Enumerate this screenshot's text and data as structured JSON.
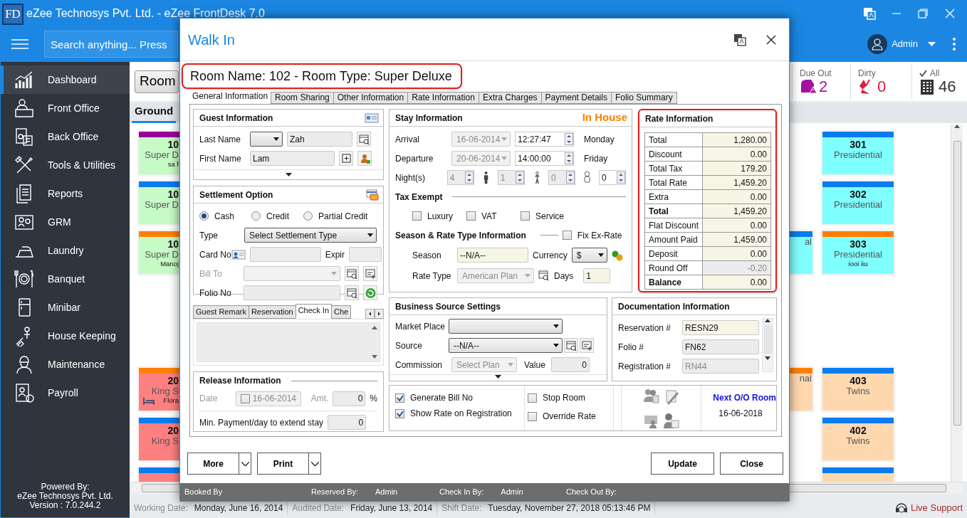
{
  "window": {
    "logo": "FD",
    "title": "eZee Technosys Pvt. Ltd. - eZee FrontDesk 7.0"
  },
  "header": {
    "search": {
      "placeholder": "Search anything... Press"
    },
    "user": "Admin"
  },
  "sidebar": {
    "items": [
      {
        "label": "Dashboard",
        "selected": true
      },
      {
        "label": "Front Office",
        "selected": false
      },
      {
        "label": "Back Office",
        "selected": false
      },
      {
        "label": "Tools & Utilities",
        "selected": false
      },
      {
        "label": "Reports",
        "selected": false
      },
      {
        "label": "GRM",
        "selected": false
      },
      {
        "label": "Laundry",
        "selected": false
      },
      {
        "label": "Banquet",
        "selected": false
      },
      {
        "label": "Minibar",
        "selected": false
      },
      {
        "label": "House Keeping",
        "selected": false
      },
      {
        "label": "Maintenance",
        "selected": false
      },
      {
        "label": "Payroll",
        "selected": false
      }
    ],
    "footer": [
      "Powered By:",
      "eZee Technosys Pvt. Ltd.",
      "Version : 7.0.244.2"
    ]
  },
  "toolbar": {
    "view_button": "Room",
    "stats": [
      {
        "label": "Due Out",
        "value": "2",
        "color": "#a3139f"
      },
      {
        "label": "Dirty",
        "value": "0",
        "color": "#e8173c"
      },
      {
        "label": "All",
        "value": "46",
        "color": "#333333"
      }
    ]
  },
  "floor_tab": "Ground",
  "rooms": {
    "left": [
      {
        "number": "10",
        "type": "Super D",
        "guest": "sa f",
        "color": "#c6fbc6",
        "strip": {
          "color": "#990099"
        },
        "occupied": false
      },
      {
        "number": "10",
        "type": "Super D",
        "color": "#c6fbc6",
        "strip": {
          "color": "#0a7cf0"
        },
        "occupied": false
      },
      {
        "number": "10",
        "type": "Super D",
        "guest": "Manoj",
        "color": "#c6fbc6",
        "strip": {
          "color": "#ff7f00"
        },
        "occupied": false
      },
      {
        "number": "20",
        "type": "King S",
        "guest": "Flora",
        "color": "#ff8080",
        "strip": {
          "color": "#ff7f00"
        },
        "occupied": true
      },
      {
        "number": "20",
        "type": "King S",
        "color": "#ff8080",
        "strip": {
          "color": "#0a7cf0"
        },
        "occupied": false
      },
      {
        "color": "#ff8080",
        "strip": {
          "color": "#0a7cf0"
        },
        "occupied": false
      }
    ],
    "partial": [
      {
        "type": "al",
        "color": "#80ffff",
        "strip": {
          "color": "#0a7cf0"
        },
        "occupied": false
      },
      {
        "type": "nal",
        "color": "#ffd8b0",
        "strip": {
          "color": "#ff7f00"
        },
        "occupied": false
      }
    ],
    "right": [
      {
        "number": "301",
        "type": "Presidential",
        "color": "#80ffff",
        "strip": {
          "color": "#0a7cf0"
        },
        "occupied": false
      },
      {
        "number": "302",
        "type": "Presidential",
        "color": "#80ffff",
        "strip": {
          "color": "#0a7cf0"
        },
        "occupied": false
      },
      {
        "number": "303",
        "type": "Presidential",
        "guest": "iooi iiu",
        "color": "#80ffff",
        "strip": {
          "color": "#ff7f00"
        },
        "occupied": false
      },
      {
        "number": "403",
        "type": "Twins",
        "color": "#ffd8b0",
        "strip": {
          "color": "#0a7cf0"
        },
        "occupied": false
      },
      {
        "number": "402",
        "type": "Twins",
        "color": "#ffd8b0",
        "strip": {
          "color": "#0a7cf0"
        },
        "occupied": false
      },
      {
        "color": "#ffd8b0",
        "strip": {
          "color": "#0a7cf0"
        },
        "occupied": false
      }
    ]
  },
  "dialog": {
    "title": "Walk In",
    "room_heading": "Room Name: 102 - Room Type: Super Deluxe",
    "tabs": [
      {
        "label": "General Information",
        "selected": true
      },
      {
        "label": "Room Sharing",
        "selected": false
      },
      {
        "label": "Other Information",
        "selected": false
      },
      {
        "label": "Rate Information",
        "selected": false
      },
      {
        "label": "Extra Charges",
        "selected": false
      },
      {
        "label": "Payment Details",
        "selected": false
      },
      {
        "label": "Folio Summary",
        "selected": false
      }
    ],
    "guest": {
      "title": "Guest Information",
      "last_name_label": "Last Name",
      "last_name": "Zah",
      "first_name_label": "First Name",
      "first_name": "Lam"
    },
    "settlement": {
      "title": "Settlement Option",
      "modes": [
        {
          "label": "Cash",
          "selected": true
        },
        {
          "label": "Credit",
          "selected": false
        },
        {
          "label": "Partial Credit",
          "selected": false
        }
      ],
      "type_label": "Type",
      "type": "Select Settlement Type",
      "card_label": "Card No",
      "expiry_label": "Expir",
      "bill_to_label": "Bill To",
      "bill_to_disabled": true,
      "folio_label": "Folio No"
    },
    "remark_tabs": [
      {
        "label": "Guest Remark",
        "selected": false
      },
      {
        "label": "Reservation",
        "selected": false
      },
      {
        "label": "Check In",
        "selected": true
      },
      {
        "label": "Che",
        "selected": false
      }
    ],
    "release": {
      "title": "Release Information",
      "date_label": "Date",
      "date": "16-06-2014",
      "date_checked": false,
      "amount_label": "Amt.",
      "amount": "0",
      "unit": "%",
      "min_payment_label": "Min. Payment/day to extend stay",
      "min_payment": "0"
    },
    "stay": {
      "title": "Stay Information",
      "status": "In House",
      "rows": [
        {
          "label": "Arrival",
          "date": "16-06-2014",
          "time": "12:27:47",
          "day": "Monday"
        },
        {
          "label": "Departure",
          "date": "20-06-2014",
          "time": "14:00:00",
          "day": "Friday"
        }
      ],
      "nights_label": "Night(s)",
      "counts": [
        {
          "value": "4",
          "disabled": true
        },
        {
          "value": "1",
          "disabled": true
        },
        {
          "value": "0",
          "disabled": true
        },
        {
          "value": "0",
          "disabled": false
        }
      ],
      "tax_title": "Tax Exempt",
      "tax_exempt": [
        {
          "label": "Luxury",
          "checked": false
        },
        {
          "label": "VAT",
          "checked": false
        },
        {
          "label": "Service",
          "checked": false
        }
      ],
      "season_title": "Season & Rate Type Information",
      "fix_ex_rate": {
        "label": "Fix Ex-Rate",
        "checked": false
      },
      "season_label": "Season",
      "season": "--N/A--",
      "currency_label": "Currency",
      "currency": "$",
      "rate_type_label": "Rate Type",
      "rate_type": "American Plan",
      "days_label": "Days",
      "days": "1"
    },
    "rate": {
      "title": "Rate Information",
      "rows": [
        {
          "label": "Total",
          "value": "1,280.00",
          "bold": false,
          "disabled": false
        },
        {
          "label": "Discount",
          "value": "0.00",
          "bold": false,
          "disabled": false
        },
        {
          "label": "Total Tax",
          "value": "179.20",
          "bold": false,
          "disabled": false
        },
        {
          "label": "Total Rate",
          "value": "1,459.20",
          "bold": false,
          "disabled": false
        },
        {
          "label": "Extra",
          "value": "0.00",
          "bold": false,
          "disabled": false
        },
        {
          "label": "Total",
          "value": "1,459.20",
          "bold": true,
          "disabled": false
        },
        {
          "label": "Flat Discount",
          "value": "0.00",
          "bold": false,
          "disabled": false
        },
        {
          "label": "Amount Paid",
          "value": "1,459.00",
          "bold": false,
          "disabled": false
        },
        {
          "label": "Deposit",
          "value": "0.00",
          "bold": false,
          "disabled": false
        },
        {
          "label": "Round Off",
          "value": "-0.20",
          "bold": false,
          "disabled": true
        },
        {
          "label": "Balance",
          "value": "0.00",
          "bold": true,
          "disabled": false
        }
      ]
    },
    "business": {
      "title": "Business Source Settings",
      "market_label": "Market Place",
      "source_label": "Source",
      "source": "--N/A--",
      "commission_label": "Commission",
      "commission": "Select Plan",
      "value_label": "Value",
      "value": "0"
    },
    "documentation": {
      "title": "Documentation Information",
      "rows": [
        {
          "label": "Reservation #",
          "value": "RESN29",
          "kind": "highlight"
        },
        {
          "label": "Folio #",
          "value": "FN62",
          "kind": "readonly"
        },
        {
          "label": "Registration #",
          "value": "RN44",
          "kind": "disabled"
        }
      ]
    },
    "flags": [
      {
        "label": "Generate Bill No",
        "checked": true
      },
      {
        "label": "Show Rate on Registration",
        "checked": true
      }
    ],
    "room_flags": [
      {
        "label": "Stop Room",
        "checked": false
      },
      {
        "label": "Override Rate",
        "checked": false
      }
    ],
    "next_room": {
      "title": "Next O/O Room",
      "date": "16-06-2018"
    },
    "buttons": {
      "more": "More",
      "print": "Print",
      "update": "Update",
      "close": "Close"
    },
    "audit": [
      {
        "label": "Booked By"
      },
      {
        "label": "Reserved By:",
        "value": "Admin"
      },
      {
        "label": "Check In By:",
        "value": "Admin"
      },
      {
        "label": "Check Out By:"
      }
    ]
  },
  "status_bar": {
    "items": [
      {
        "label": "Working Date:",
        "value": "Monday, June 16, 2014"
      },
      {
        "label": "Audited Date:",
        "value": "Friday, June 13, 2014"
      },
      {
        "label": "Shift Date:",
        "value": "Tuesday, November 27, 2018 05:13:46 PM"
      }
    ],
    "support": "Live Support"
  }
}
